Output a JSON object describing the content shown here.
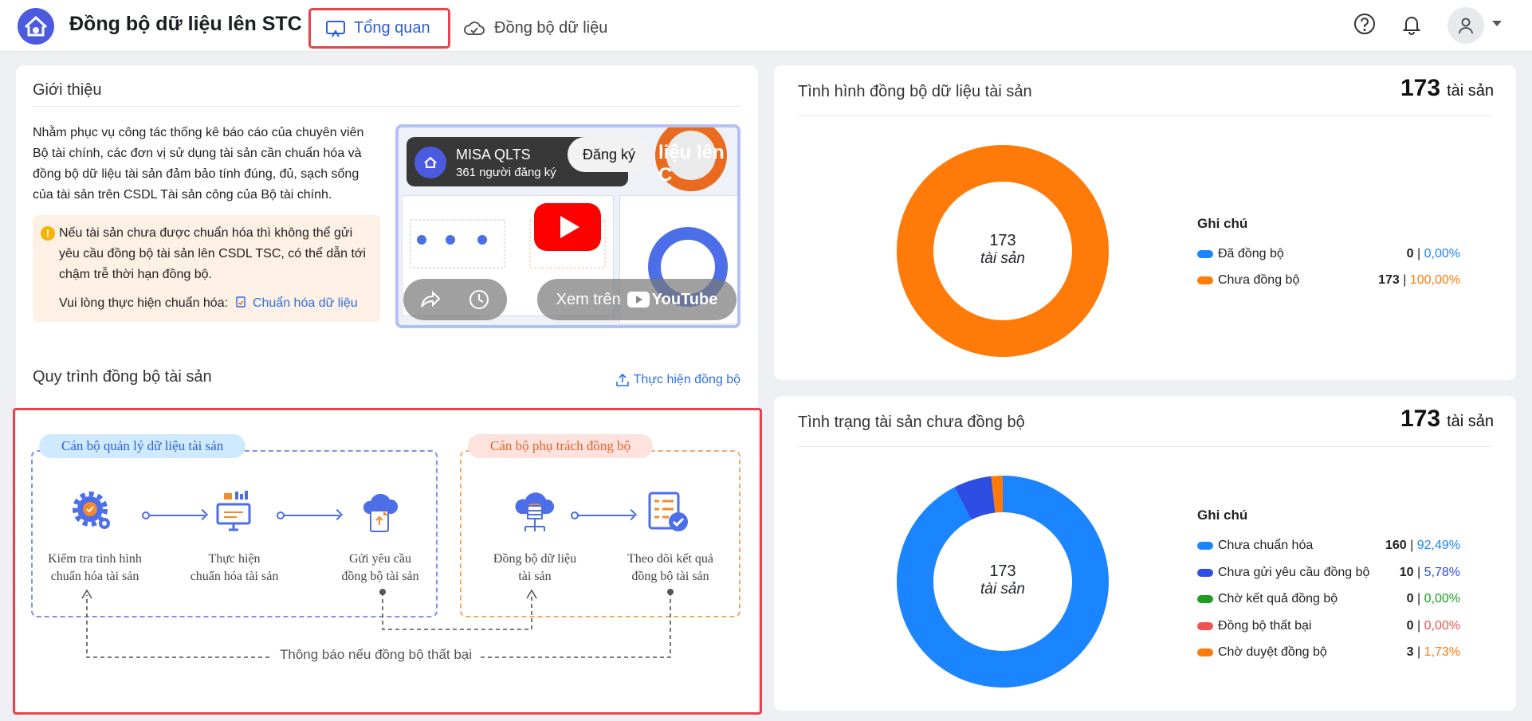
{
  "header": {
    "title": "Đồng bộ dữ liệu lên STC",
    "tabs": [
      {
        "label": "Tổng quan",
        "active": true
      },
      {
        "label": "Đồng bộ dữ liệu",
        "active": false
      }
    ],
    "icons": [
      "help-icon",
      "bell-icon",
      "user-icon"
    ]
  },
  "intro": {
    "title": "Giới thiệu",
    "lines": [
      "Nhằm phục vụ công tác thống kê báo cáo của chuyên viên",
      "Bộ tài chính, các đơn vị sử dụng tài sản cần chuẩn hóa và",
      "đồng bộ dữ liệu tài sản đảm bảo tính đúng, đủ, sạch sống",
      "của tài sản trên CSDL Tài sản công của Bộ tài chính."
    ],
    "warning_lines": [
      "Nếu tài sản chưa được chuẩn hóa thì không thể gửi",
      "yêu cầu đồng bộ tài sản lên CSDL TSC, có thể dẫn tới",
      "chậm trễ thời hạn đồng bộ."
    ],
    "warning_action": "Vui lòng thực hiện chuẩn hóa:",
    "warning_link": "Chuẩn hóa dữ liệu"
  },
  "video": {
    "channel": "MISA QLTS",
    "subscribers": "361 người đăng ký",
    "subscribe_label": "Đăng ký",
    "title_fragment": "liệu lên C",
    "watch_label": "Xem trên",
    "brand": "YouTube"
  },
  "process": {
    "title": "Quy trình đồng bộ tài sản",
    "action_label": "Thực hiện đồng bộ",
    "group_a": "Cán bộ quản lý dữ liệu tài sản",
    "group_b": "Cán bộ phụ trách đồng bộ",
    "steps": [
      {
        "line1": "Kiểm tra tình hình",
        "line2": "chuẩn hóa tài sản"
      },
      {
        "line1": "Thực hiện",
        "line2": "chuẩn hóa tài sản"
      },
      {
        "line1": "Gửi yêu cầu",
        "line2": "đồng bộ tài sản"
      },
      {
        "line1": "Đồng bộ dữ liệu",
        "line2": "tài sản"
      },
      {
        "line1": "Theo dõi kết quả",
        "line2": "đồng bộ tài sản"
      }
    ],
    "fail_note": "Thông báo nếu đồng bộ thất bại"
  },
  "sync_status": {
    "title": "Tình hình đồng bộ dữ liệu tài sản",
    "total": "173",
    "unit": "tài sản",
    "legend_title": "Ghi chú",
    "legend": [
      {
        "label": "Đã đồng bộ",
        "count": "0",
        "pct": "0,00%",
        "color": "#1a85ff"
      },
      {
        "label": "Chưa đồng bộ",
        "count": "173",
        "pct": "100,00%",
        "color": "#fe7a09"
      }
    ]
  },
  "unsynced_status": {
    "title": "Tình trạng tài sản chưa đồng bộ",
    "total": "173",
    "unit": "tài sản",
    "legend_title": "Ghi chú",
    "legend": [
      {
        "label": "Chưa chuẩn hóa",
        "count": "160",
        "pct": "92,49%",
        "color": "#1a85ff"
      },
      {
        "label": "Chưa gửi yêu cầu đồng bộ",
        "count": "10",
        "pct": "5,78%",
        "color": "#2e4ee3"
      },
      {
        "label": "Chờ kết quả đồng bộ",
        "count": "0",
        "pct": "0,00%",
        "color": "#1e9e1e"
      },
      {
        "label": "Đồng bộ thất bại",
        "count": "0",
        "pct": "0,00%",
        "color": "#ef5350"
      },
      {
        "label": "Chờ duyệt đồng bộ",
        "count": "3",
        "pct": "1,73%",
        "color": "#fe7a09"
      }
    ]
  },
  "chart_data": [
    {
      "type": "pie",
      "title": "Tình hình đồng bộ dữ liệu tài sản",
      "categories": [
        "Đã đồng bộ",
        "Chưa đồng bộ"
      ],
      "values": [
        0,
        173
      ],
      "colors": [
        "#1a85ff",
        "#fe7a09"
      ],
      "center_label": "173 tài sản",
      "legend": "right"
    },
    {
      "type": "pie",
      "title": "Tình trạng tài sản chưa đồng bộ",
      "categories": [
        "Chưa chuẩn hóa",
        "Chưa gửi yêu cầu đồng bộ",
        "Chờ kết quả đồng bộ",
        "Đồng bộ thất bại",
        "Chờ duyệt đồng bộ"
      ],
      "values": [
        160,
        10,
        0,
        0,
        3
      ],
      "colors": [
        "#1a85ff",
        "#2e4ee3",
        "#1e9e1e",
        "#ef5350",
        "#fe7a09"
      ],
      "center_label": "173 tài sản",
      "legend": "right"
    }
  ]
}
